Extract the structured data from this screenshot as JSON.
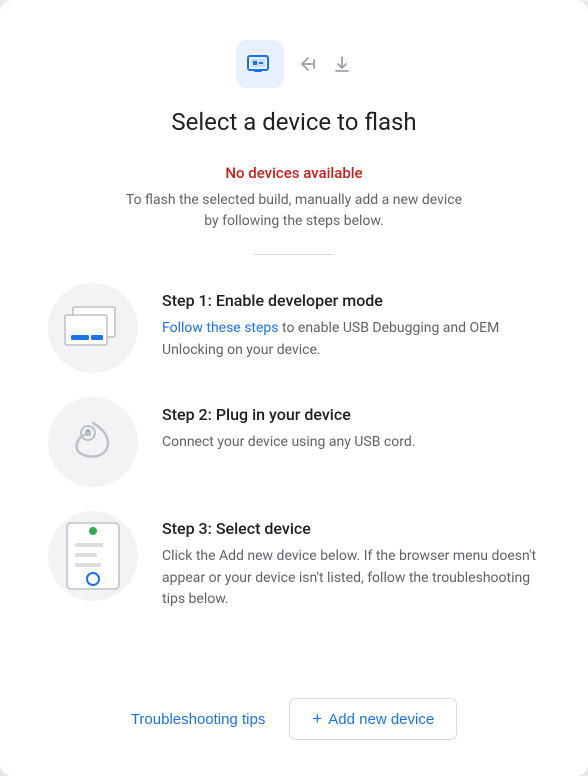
{
  "header": {
    "title": "Select a device to flash"
  },
  "icons": {
    "device_icon": "device-flash-icon",
    "back_icon": "←",
    "download_icon": "↓"
  },
  "status": {
    "no_devices_label": "No devices available",
    "subtitle": "To flash the selected build, manually add a new device by following the steps below."
  },
  "steps": [
    {
      "number": 1,
      "title": "Step 1: Enable developer mode",
      "link_text": "Follow these steps",
      "description": " to enable USB Debugging and OEM Unlocking on your device."
    },
    {
      "number": 2,
      "title": "Step 2: Plug in your device",
      "description": "Connect your device using any USB cord."
    },
    {
      "number": 3,
      "title": "Step 3: Select device",
      "description": "Click the Add new device below. If the browser menu doesn't appear or your device isn't listed, follow the troubleshooting tips below."
    }
  ],
  "footer": {
    "troubleshoot_label": "Troubleshooting tips",
    "add_device_label": "Add new device",
    "add_icon": "+"
  }
}
